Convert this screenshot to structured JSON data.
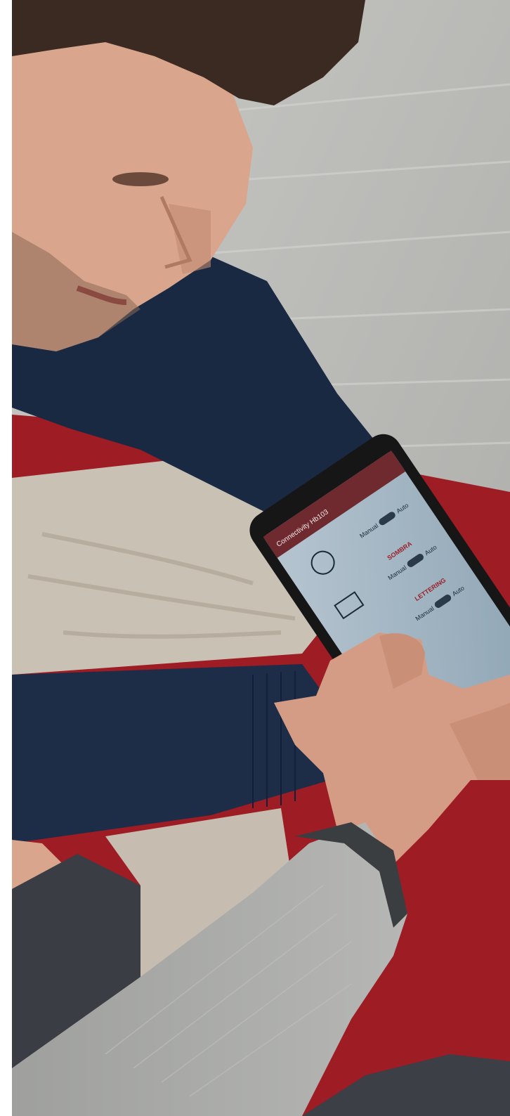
{
  "scene": {
    "description_note": "",
    "colors": {
      "floor": "#b9b9b6",
      "sofa_red": "#9e1c24",
      "sweater_navy": "#1a2942",
      "trousers_beige": "#c9c1b4",
      "skin": "#d9a58c",
      "hair": "#3a2a22",
      "jacket_grey": "#a9aaa8",
      "phone_screen": "#9fb3c1",
      "app_header": "#6e2a2e"
    }
  },
  "phone": {
    "app_title": "Connectivity Hb103",
    "rows": [
      {
        "label": "",
        "left": "Manual",
        "right": "Auto"
      },
      {
        "label": "SOMBRA",
        "left": "Manual",
        "right": "Auto"
      },
      {
        "label": "LETTERING",
        "left": "Manual",
        "right": "Auto"
      }
    ]
  }
}
